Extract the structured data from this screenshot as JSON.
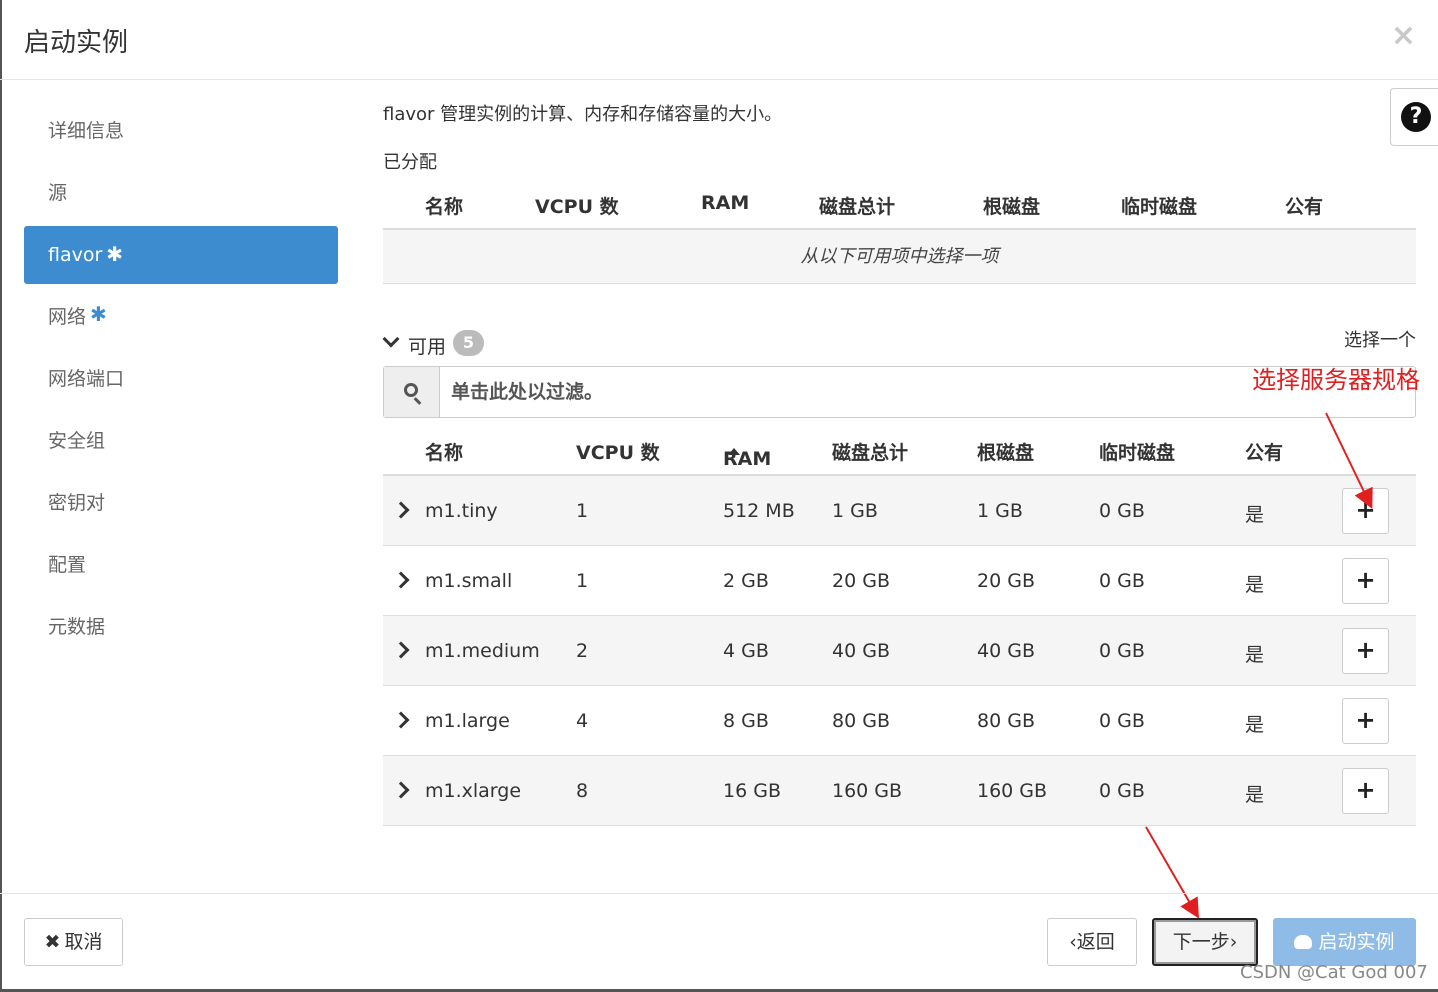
{
  "dialog": {
    "title": "启动实例",
    "close_icon": "×"
  },
  "sidebar": {
    "items": [
      {
        "label": "详细信息",
        "required": false
      },
      {
        "label": "源",
        "required": false
      },
      {
        "label": "flavor",
        "required": true,
        "active": true
      },
      {
        "label": "网络",
        "required": true
      },
      {
        "label": "网络端口",
        "required": false
      },
      {
        "label": "安全组",
        "required": false
      },
      {
        "label": "密钥对",
        "required": false
      },
      {
        "label": "配置",
        "required": false
      },
      {
        "label": "元数据",
        "required": false
      }
    ],
    "required_marker": "✱"
  },
  "help": {
    "icon": "?"
  },
  "main": {
    "description": "flavor 管理实例的计算、内存和存储容量的大小。",
    "allocated_label": "已分配",
    "allocated_headers": [
      "名称",
      "VCPU 数",
      "RAM",
      "磁盘总计",
      "根磁盘",
      "临时磁盘",
      "公有"
    ],
    "allocated_empty": "从以下可用项中选择一项",
    "available_label": "可用",
    "available_count": "5",
    "choose_one": "选择一个",
    "search_placeholder": "单击此处以过滤。",
    "available_headers": [
      "名称",
      "VCPU 数",
      "RAM",
      "磁盘总计",
      "根磁盘",
      "临时磁盘",
      "公有"
    ],
    "rows": [
      {
        "name": "m1.tiny",
        "vcpu": "1",
        "ram": "512 MB",
        "disk": "1 GB",
        "root": "1 GB",
        "ephemeral": "0 GB",
        "public": "是"
      },
      {
        "name": "m1.small",
        "vcpu": "1",
        "ram": "2 GB",
        "disk": "20 GB",
        "root": "20 GB",
        "ephemeral": "0 GB",
        "public": "是"
      },
      {
        "name": "m1.medium",
        "vcpu": "2",
        "ram": "4 GB",
        "disk": "40 GB",
        "root": "40 GB",
        "ephemeral": "0 GB",
        "public": "是"
      },
      {
        "name": "m1.large",
        "vcpu": "4",
        "ram": "8 GB",
        "disk": "80 GB",
        "root": "80 GB",
        "ephemeral": "0 GB",
        "public": "是"
      },
      {
        "name": "m1.xlarge",
        "vcpu": "8",
        "ram": "16 GB",
        "disk": "160 GB",
        "root": "160 GB",
        "ephemeral": "0 GB",
        "public": "是"
      }
    ],
    "add_icon": "+"
  },
  "annotation": {
    "text": "选择服务器规格",
    "color": "#e02020"
  },
  "footer": {
    "cancel_icon": "✖",
    "cancel_label": "取消",
    "back_label": "‹返回",
    "next_label": "下一步›",
    "launch_label": "启动实例",
    "launch_icon": "cloud-upload-icon"
  },
  "watermark": "CSDN @Cat God 007",
  "colors": {
    "accent": "#3e8cd0",
    "launch_disabled": "#8fbce6",
    "annotation": "#e02020"
  }
}
